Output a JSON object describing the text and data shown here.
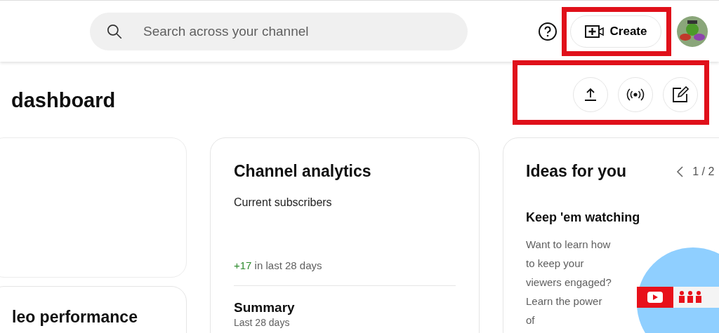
{
  "header": {
    "search": {
      "placeholder": "Search across your channel"
    },
    "create_button": {
      "label": "Create",
      "highlighted": true
    }
  },
  "page": {
    "title": "dashboard",
    "actions_highlighted": true
  },
  "performance_card": {
    "title": "leo performance"
  },
  "analytics": {
    "title": "Channel analytics",
    "subscribers_label": "Current subscribers",
    "change": "+17",
    "change_suffix": "in last 28 days",
    "summary_title": "Summary",
    "summary_period": "Last 28 days"
  },
  "ideas": {
    "title": "Ideas for you",
    "pager": "1 / 2",
    "idea_title": "Keep 'em watching",
    "idea_text": "Want to learn how to keep your viewers engaged? Learn the power of"
  }
}
